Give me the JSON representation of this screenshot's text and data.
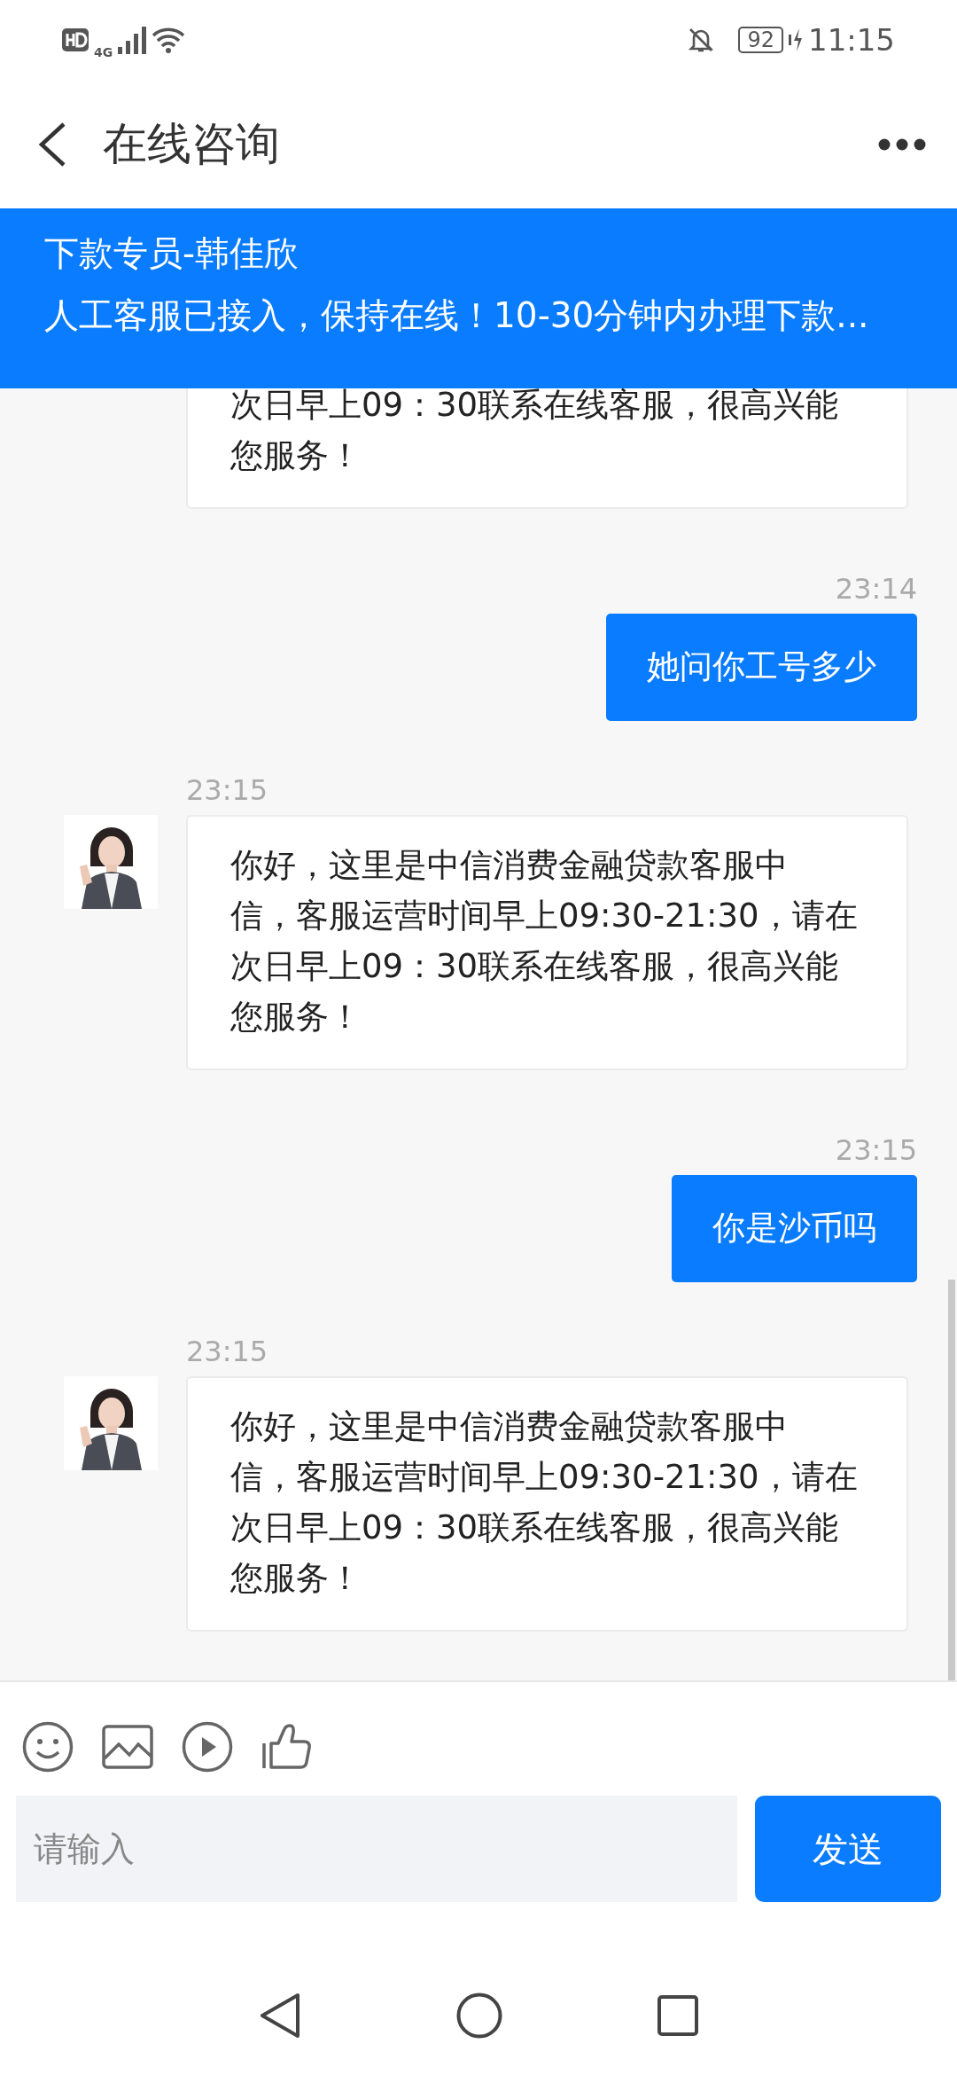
{
  "status_bar": {
    "network": "4G",
    "battery": "92",
    "time": "11:15"
  },
  "header": {
    "title": "在线咨询"
  },
  "banner": {
    "title": "下款专员-韩佳欣",
    "message": "人工客服已接入，保持在线！10-30分钟内办理下款..."
  },
  "messages": [
    {
      "kind": "agent",
      "clipped": true,
      "lines": [
        "次日早上09：30联系在线客服，很高兴能",
        "您服务！"
      ]
    },
    {
      "kind": "user",
      "time": "23:14",
      "lines": [
        "她问你工号多少"
      ]
    },
    {
      "kind": "agent",
      "time": "23:15",
      "lines": [
        "你好，这里是中信消费金融贷款客服中",
        "信，客服运营时间早上09:30-21:30，请在",
        "次日早上09：30联系在线客服，很高兴能",
        "您服务！"
      ]
    },
    {
      "kind": "user",
      "time": "23:15",
      "lines": [
        "你是沙币吗"
      ]
    },
    {
      "kind": "agent",
      "time": "23:15",
      "lines": [
        "你好，这里是中信消费金融贷款客服中",
        "信，客服运营时间早上09:30-21:30，请在",
        "次日早上09：30联系在线客服，很高兴能",
        "您服务！"
      ]
    }
  ],
  "composer": {
    "placeholder": "请输入",
    "send": "发送"
  }
}
